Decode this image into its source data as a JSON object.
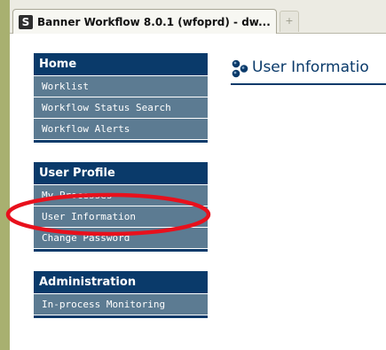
{
  "browser": {
    "tab_title": "Banner Workflow 8.0.1 (wfoprd) - dw...",
    "favicon_letter": "S",
    "new_tab_symbol": "+"
  },
  "sidebar": {
    "home": {
      "header": "Home",
      "items": [
        "Worklist",
        "Workflow Status Search",
        "Workflow Alerts"
      ]
    },
    "user_profile": {
      "header": "User Profile",
      "items": [
        "My Processes",
        "User Information",
        "Change Password"
      ]
    },
    "administration": {
      "header": "Administration",
      "items": [
        "In-process Monitoring"
      ]
    }
  },
  "main": {
    "title": "User Informatio"
  },
  "colors": {
    "header_bg": "#0a3a6a",
    "item_bg": "#5c7b92",
    "annotation": "#e8101c"
  }
}
